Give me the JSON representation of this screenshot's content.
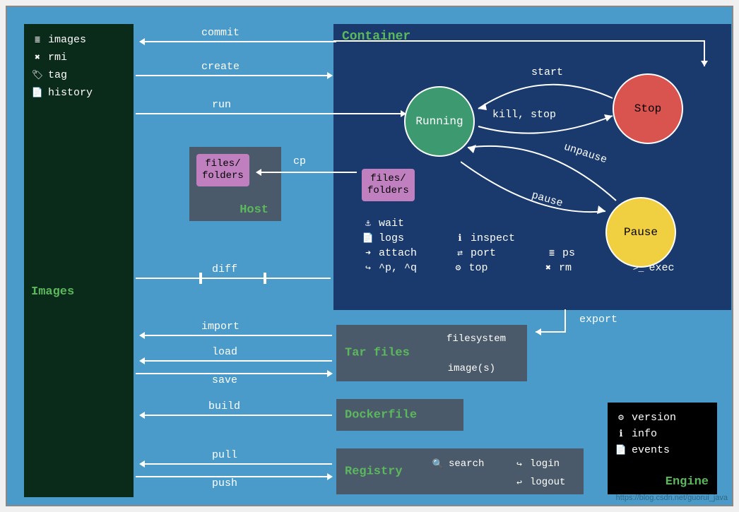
{
  "images_panel": {
    "items": [
      {
        "icon": "≣",
        "label": "images"
      },
      {
        "icon": "✖",
        "label": "rmi"
      },
      {
        "icon": "🏷",
        "label": "tag"
      },
      {
        "icon": "📄",
        "label": "history"
      }
    ],
    "title": "Images"
  },
  "container": {
    "title": "Container",
    "states": {
      "running": "Running",
      "stop": "Stop",
      "pause": "Pause"
    },
    "edges": {
      "start": "start",
      "kill_stop": "kill, stop",
      "pause": "pause",
      "unpause": "unpause"
    },
    "files_folders": "files/\nfolders",
    "commands": [
      [
        {
          "icon": "⚓",
          "label": "wait"
        }
      ],
      [
        {
          "icon": "📄",
          "label": "logs"
        },
        {
          "icon": "ℹ",
          "label": "inspect"
        }
      ],
      [
        {
          "icon": "➜",
          "label": "attach"
        },
        {
          "icon": "⇄",
          "label": "port"
        },
        {
          "icon": "≣",
          "label": "ps"
        }
      ],
      [
        {
          "icon": "↪",
          "label": "^p, ^q"
        },
        {
          "icon": "⚙",
          "label": "top"
        },
        {
          "icon": "✖",
          "label": "rm"
        },
        {
          "icon": ">_",
          "label": "exec"
        }
      ]
    ]
  },
  "host": {
    "files_folders": "files/\nfolders",
    "title": "Host",
    "cp": "cp"
  },
  "edges": {
    "commit": "commit",
    "create": "create",
    "run": "run",
    "diff": "diff",
    "import": "import",
    "load": "load",
    "save": "save",
    "build": "build",
    "pull": "pull",
    "push": "push",
    "export": "export"
  },
  "tarfiles": {
    "title": "Tar files",
    "filesystem": "filesystem",
    "images": "image(s)"
  },
  "dockerfile": {
    "title": "Dockerfile"
  },
  "registry": {
    "title": "Registry",
    "commands": [
      {
        "icon": "🔍",
        "label": "search"
      },
      {
        "icon": "↪",
        "label": "login"
      },
      {
        "icon": "↩",
        "label": "logout"
      }
    ]
  },
  "engine": {
    "items": [
      {
        "icon": "⚙",
        "label": "version"
      },
      {
        "icon": "ℹ",
        "label": "info"
      },
      {
        "icon": "📄",
        "label": "events"
      }
    ],
    "title": "Engine"
  },
  "watermark": "https://blog.csdn.net/guorui_java"
}
